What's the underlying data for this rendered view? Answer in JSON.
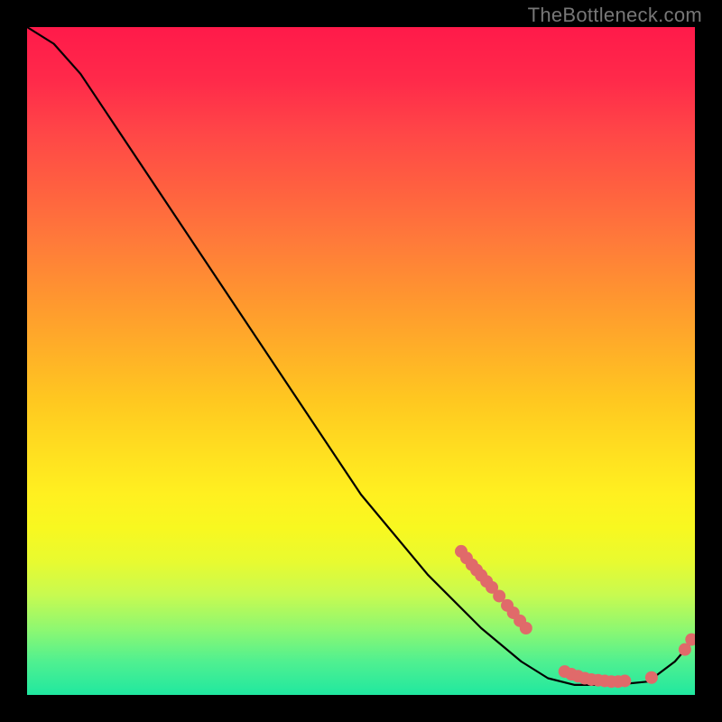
{
  "watermark": "TheBottleneck.com",
  "chart_data": {
    "type": "line",
    "title": "",
    "xlabel": "",
    "ylabel": "",
    "xlim": [
      0,
      100
    ],
    "ylim": [
      0,
      100
    ],
    "grid": false,
    "legend": false,
    "curve": [
      {
        "x": 0,
        "y": 100
      },
      {
        "x": 4,
        "y": 97.5
      },
      {
        "x": 8,
        "y": 93
      },
      {
        "x": 12,
        "y": 87
      },
      {
        "x": 20,
        "y": 75
      },
      {
        "x": 30,
        "y": 60
      },
      {
        "x": 40,
        "y": 45
      },
      {
        "x": 50,
        "y": 30
      },
      {
        "x": 60,
        "y": 18
      },
      {
        "x": 68,
        "y": 10
      },
      {
        "x": 74,
        "y": 5
      },
      {
        "x": 78,
        "y": 2.5
      },
      {
        "x": 82,
        "y": 1.5
      },
      {
        "x": 88,
        "y": 1.5
      },
      {
        "x": 93,
        "y": 2
      },
      {
        "x": 97,
        "y": 5
      },
      {
        "x": 100,
        "y": 8.5
      }
    ],
    "point_clusters": [
      {
        "note": "upper diagonal cluster",
        "points": [
          {
            "x": 65.0,
            "y": 21.5
          },
          {
            "x": 65.8,
            "y": 20.5
          },
          {
            "x": 66.6,
            "y": 19.5
          },
          {
            "x": 67.3,
            "y": 18.7
          },
          {
            "x": 68.0,
            "y": 17.9
          },
          {
            "x": 68.8,
            "y": 17.0
          },
          {
            "x": 69.6,
            "y": 16.1
          },
          {
            "x": 70.7,
            "y": 14.8
          },
          {
            "x": 71.9,
            "y": 13.4
          },
          {
            "x": 72.8,
            "y": 12.3
          },
          {
            "x": 73.8,
            "y": 11.1
          },
          {
            "x": 74.7,
            "y": 10.0
          }
        ]
      },
      {
        "note": "bottom flat cluster",
        "points": [
          {
            "x": 80.5,
            "y": 3.5
          },
          {
            "x": 81.5,
            "y": 3.1
          },
          {
            "x": 82.5,
            "y": 2.8
          },
          {
            "x": 83.5,
            "y": 2.5
          },
          {
            "x": 84.5,
            "y": 2.3
          },
          {
            "x": 85.5,
            "y": 2.2
          },
          {
            "x": 86.5,
            "y": 2.1
          },
          {
            "x": 87.5,
            "y": 2.0
          },
          {
            "x": 88.5,
            "y": 2.0
          },
          {
            "x": 89.5,
            "y": 2.1
          },
          {
            "x": 93.5,
            "y": 2.6
          }
        ]
      },
      {
        "note": "right uptick pair",
        "points": [
          {
            "x": 98.5,
            "y": 6.8
          },
          {
            "x": 99.5,
            "y": 8.3
          }
        ]
      }
    ],
    "point_color": "#e06a6a",
    "curve_color": "#000000"
  }
}
